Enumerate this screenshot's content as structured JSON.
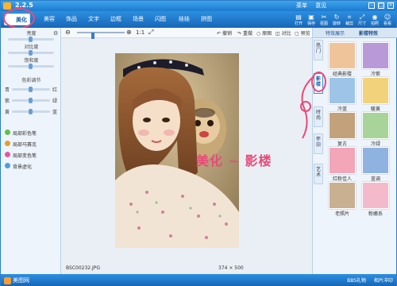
{
  "app": {
    "title": "2.2.5"
  },
  "title_links": [
    "菜单",
    "意见"
  ],
  "tabs": [
    {
      "label": "美化",
      "color": "#5fbf4a"
    },
    {
      "label": "美容",
      "color": "#ff7ba8"
    },
    {
      "label": "饰品",
      "color": "#ffb43a"
    },
    {
      "label": "文字",
      "color": "#7a6cf2"
    },
    {
      "label": "边框",
      "color": "#37b2f0"
    },
    {
      "label": "场景",
      "color": "#37b2f0"
    },
    {
      "label": "闪图",
      "color": "#9ad24a"
    },
    {
      "label": "娃娃",
      "color": "#f0a05a"
    },
    {
      "label": "拼图",
      "color": "#e67ad0"
    }
  ],
  "toolbar": [
    {
      "label": "打开",
      "icon": "folder-icon"
    },
    {
      "label": "保存",
      "icon": "save-icon"
    },
    {
      "label": "抠图",
      "icon": "cutout-icon"
    },
    {
      "label": "旋转",
      "icon": "rotate-icon"
    },
    {
      "label": "裁剪",
      "icon": "crop-icon"
    },
    {
      "label": "尺寸",
      "icon": "resize-icon"
    },
    {
      "label": "拍照",
      "icon": "camera-icon"
    },
    {
      "label": "看看",
      "icon": "view-icon"
    }
  ],
  "left_panel": {
    "sliders": [
      {
        "label": "亮度",
        "level": 0.5
      },
      {
        "label": "对比度",
        "level": 0.5
      },
      {
        "label": "饱和度",
        "level": 0.5
      }
    ],
    "color_title": "色彩调节",
    "color_sliders": [
      {
        "left": "青",
        "right": "红",
        "level": 0.5
      },
      {
        "left": "紫",
        "right": "绿",
        "level": 0.5
      },
      {
        "left": "黄",
        "right": "蓝",
        "level": 0.5
      }
    ],
    "effects": [
      {
        "label": "局部彩色笔",
        "color": "#5fbf4a"
      },
      {
        "label": "局部马赛克",
        "color": "#e0a030"
      },
      {
        "label": "局部变色笔",
        "color": "#e05aa0"
      },
      {
        "label": "背景虚化",
        "color": "#4a9fe0"
      }
    ]
  },
  "canvas": {
    "zoom_ratio": "1:1",
    "actions": [
      "撤销",
      "重做",
      "原图",
      "对比",
      "预览"
    ],
    "filename": "BSC00232.JPG",
    "dimensions": "374 × 500"
  },
  "right_panel": {
    "tabs": [
      "特效展示",
      "影楼特效"
    ],
    "vertical_tabs": [
      "热门",
      "影楼",
      "时尚",
      "怀旧",
      "艺术"
    ],
    "thumbnails": [
      {
        "label": "经典影楼",
        "color": "#f0c49a"
      },
      {
        "label": "冷紫",
        "color": "#b89ad8"
      },
      {
        "label": "冷蓝",
        "color": "#9ec4e8"
      },
      {
        "label": "暖黄",
        "color": "#f2d27a"
      },
      {
        "label": "复古",
        "color": "#c2a27a"
      },
      {
        "label": "冷绿",
        "color": "#a8d49a"
      },
      {
        "label": "红粉佳人",
        "color": "#f2a6b8"
      },
      {
        "label": "蓝调",
        "color": "#8fb2e0"
      },
      {
        "label": "老照片",
        "color": "#c9b091"
      },
      {
        "label": "粉嫩系",
        "color": "#f5b9cc"
      }
    ]
  },
  "annotation": {
    "text": "美化 ~ 影楼",
    "accent": "#e84a79"
  },
  "bottom_bar": {
    "left": "美图网",
    "right": [
      "BBS礼物",
      "相片冲印"
    ]
  }
}
